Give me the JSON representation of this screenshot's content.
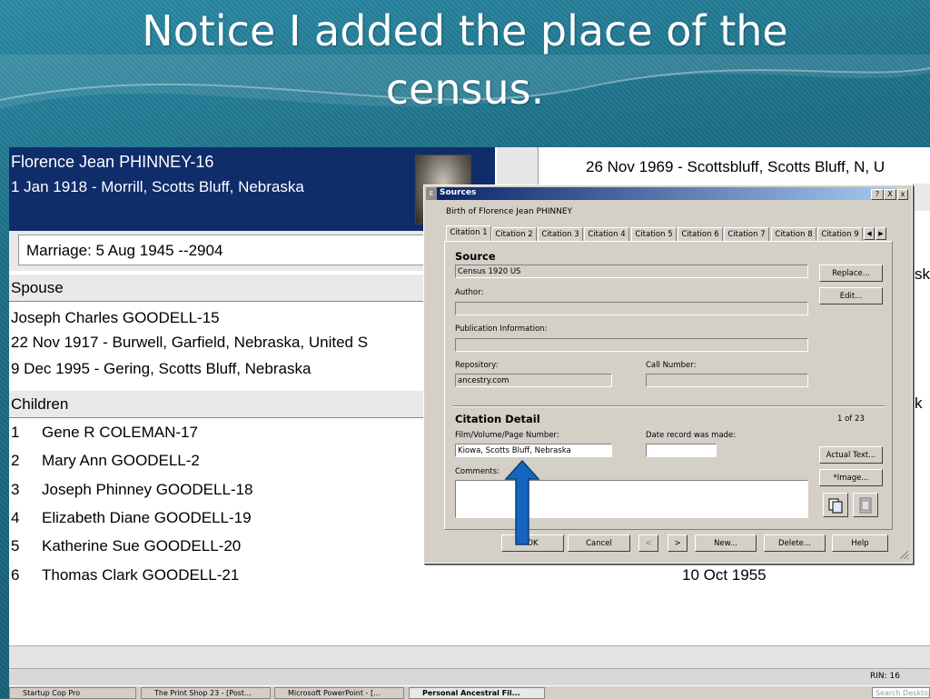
{
  "slide": {
    "title_line1": "Notice I added the place of the",
    "title_line2": "census."
  },
  "paf": {
    "person_name": "Florence Jean PHINNEY-16",
    "person_birth": "1 Jan 1918 - Morrill, Scotts Bluff, Nebraska",
    "right_event": "26 Nov 1969 - Scottsbluff, Scotts Bluff, N, U",
    "marriage": "Marriage: 5 Aug 1945 --2904",
    "spouse_heading": "Spouse",
    "spouse_name": "Joseph Charles GOODELL-15",
    "spouse_birth": "22 Nov 1917 - Burwell, Garfield, Nebraska, United S",
    "spouse_death": "9 Dec 1995 - Gering, Scotts Bluff, Nebraska",
    "children_heading": "Children",
    "children": [
      {
        "num": "1",
        "name": "Gene R COLEMAN-17"
      },
      {
        "num": "2",
        "name": "Mary Ann GOODELL-2"
      },
      {
        "num": "3",
        "name": "Joseph Phinney GOODELL-18"
      },
      {
        "num": "4",
        "name": "Elizabeth Diane GOODELL-19"
      },
      {
        "num": "5",
        "name": "Katherine Sue GOODELL-20"
      },
      {
        "num": "6",
        "name": "Thomas Clark GOODELL-21"
      }
    ],
    "right_date": "10 Oct 1955",
    "right_frag_1": "sk",
    "right_frag_2": "k",
    "rin": "RIN: 16"
  },
  "taskbar": {
    "items": [
      "Startup Cop Pro",
      "The Print Shop 23 - [Post...",
      "Microsoft PowerPoint - [...",
      "Personal Ancestral Fil..."
    ],
    "search": "Search Desktop"
  },
  "dialog": {
    "title": "Sources",
    "help_btn": "?",
    "close_btn": "X",
    "event": "Birth of Florence Jean PHINNEY",
    "tabs": [
      "Citation 1",
      "Citation 2",
      "Citation 3",
      "Citation 4",
      "Citation 5",
      "Citation 6",
      "Citation 7",
      "Citation 8",
      "Citation 9"
    ],
    "source_heading": "Source",
    "source_value": "Census 1920 US",
    "author_label": "Author:",
    "author_value": "",
    "pubinfo_label": "Publication Information:",
    "pubinfo_value": "",
    "repository_label": "Repository:",
    "repository_value": "ancestry.com",
    "callnumber_label": "Call Number:",
    "callnumber_value": "",
    "citation_heading": "Citation Detail",
    "citation_count": "1 of 23",
    "film_label": "Film/Volume/Page Number:",
    "film_value": "Kiowa, Scotts Bluff, Nebraska",
    "date_label": "Date record was made:",
    "date_value": "",
    "comments_label": "Comments:",
    "comments_value": "",
    "buttons": {
      "replace": "Replace...",
      "edit": "Edit...",
      "actual_text": "Actual Text...",
      "image": "*Image...",
      "ok": "OK",
      "cancel": "Cancel",
      "prev": "<",
      "next": ">",
      "new": "New...",
      "delete": "Delete...",
      "help": "Help"
    }
  },
  "colors": {
    "header_bg": "#0f2c6b",
    "titlebar_start": "#0a246a",
    "arrow": "#1565c0"
  }
}
